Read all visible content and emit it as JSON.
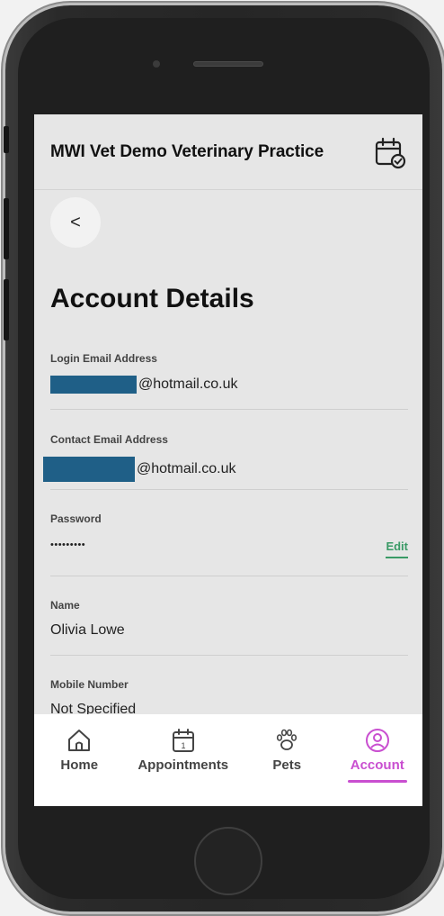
{
  "header": {
    "title": "MWI Vet Demo Veterinary Practice",
    "icon": "calendar-check-icon"
  },
  "back": {
    "icon": "chevron-left-icon",
    "glyph": "<"
  },
  "page": {
    "title": "Account Details"
  },
  "fields": {
    "login_email": {
      "label": "Login Email Address",
      "value_suffix": "@hotmail.co.uk"
    },
    "contact_email": {
      "label": "Contact Email Address",
      "value_suffix": "@hotmail.co.uk"
    },
    "password": {
      "label": "Password",
      "value": "•••••••••",
      "edit_label": "Edit"
    },
    "name": {
      "label": "Name",
      "value": "Olivia Lowe"
    },
    "mobile": {
      "label": "Mobile Number",
      "value": "Not Specified"
    }
  },
  "tabs": [
    {
      "label": "Home",
      "icon": "home-icon"
    },
    {
      "label": "Appointments",
      "icon": "calendar-icon",
      "day": "1"
    },
    {
      "label": "Pets",
      "icon": "paw-icon"
    },
    {
      "label": "Account",
      "icon": "user-circle-icon",
      "active": true
    }
  ],
  "colors": {
    "accent": "#c94fd0",
    "edit": "#3a9a66",
    "redaction": "#1f5f87"
  }
}
